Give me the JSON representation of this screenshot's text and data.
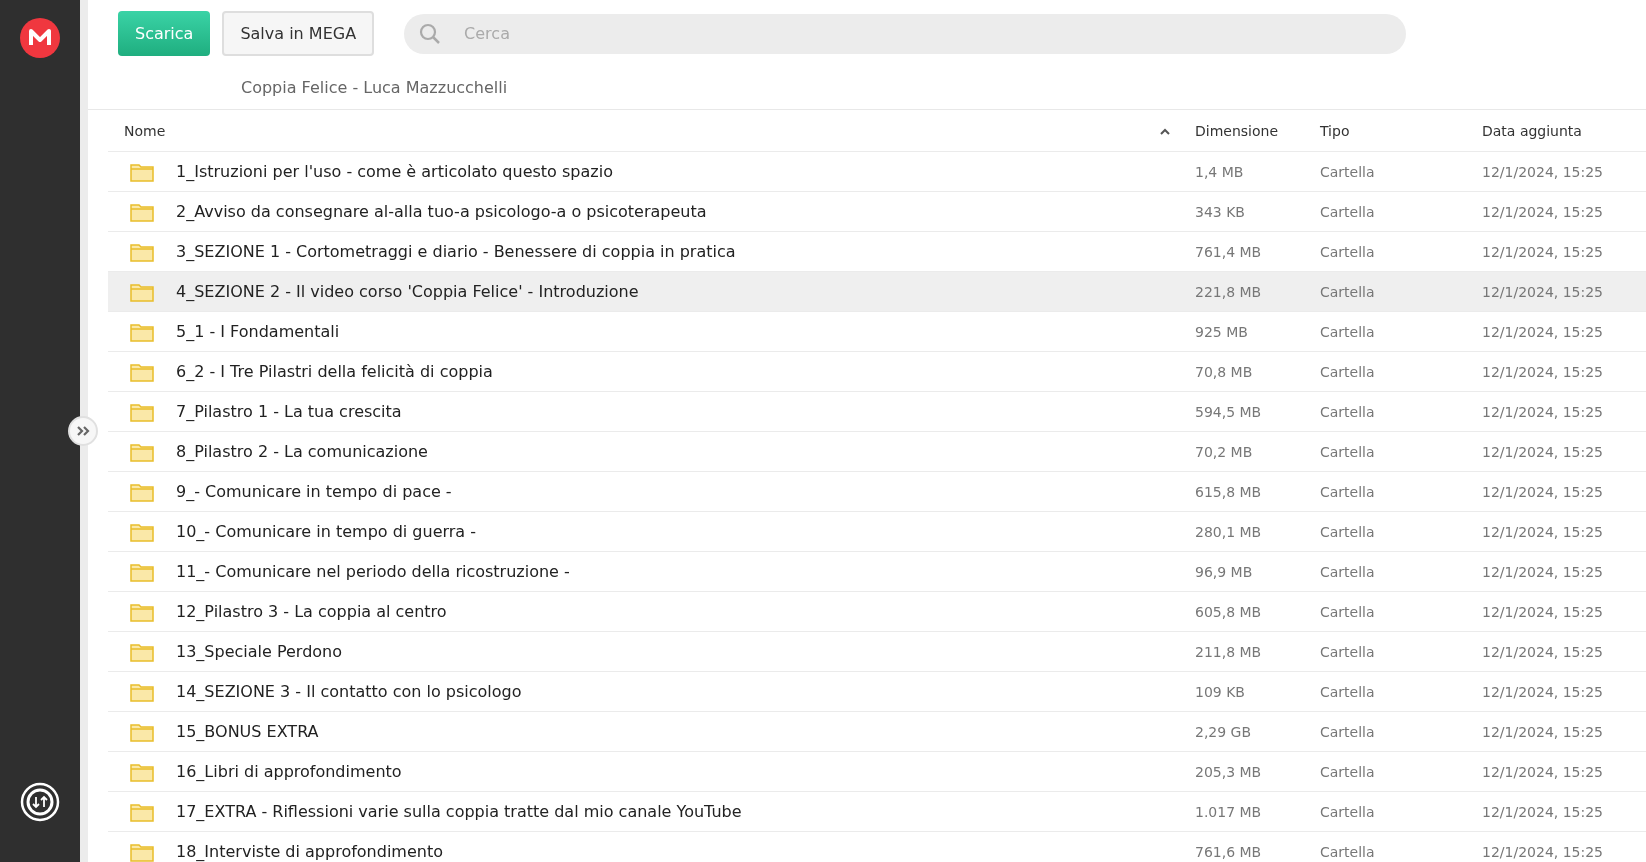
{
  "toolbar": {
    "download_label": "Scarica",
    "save_label": "Salva in MEGA",
    "search": {
      "placeholder": "Cerca"
    }
  },
  "breadcrumb": "Coppia Felice - Luca Mazzucchelli",
  "table": {
    "columns": [
      {
        "label": "Nome",
        "sorted": true
      },
      {
        "label": "Dimensione",
        "sorted": false
      },
      {
        "label": "Tipo",
        "sorted": false
      },
      {
        "label": "Data aggiunta",
        "sorted": false
      }
    ],
    "rows": [
      {
        "name": "1_Istruzioni per l'uso - come è articolato questo spazio",
        "size": "1,4 MB",
        "type": "Cartella",
        "date": "12/1/2024, 15:25",
        "highlighted": false
      },
      {
        "name": "2_Avviso da consegnare al-alla tuo-a psicologo-a o psicoterapeuta",
        "size": "343 KB",
        "type": "Cartella",
        "date": "12/1/2024, 15:25",
        "highlighted": false
      },
      {
        "name": "3_SEZIONE 1 - Cortometraggi e diario - Benessere di coppia in pratica",
        "size": "761,4 MB",
        "type": "Cartella",
        "date": "12/1/2024, 15:25",
        "highlighted": false
      },
      {
        "name": "4_SEZIONE 2 - Il video corso 'Coppia Felice' - Introduzione",
        "size": "221,8 MB",
        "type": "Cartella",
        "date": "12/1/2024, 15:25",
        "highlighted": true
      },
      {
        "name": "5_1 - I Fondamentali",
        "size": "925 MB",
        "type": "Cartella",
        "date": "12/1/2024, 15:25",
        "highlighted": false
      },
      {
        "name": "6_2 - I Tre Pilastri della felicità di coppia",
        "size": "70,8 MB",
        "type": "Cartella",
        "date": "12/1/2024, 15:25",
        "highlighted": false
      },
      {
        "name": "7_Pilastro 1 - La tua crescita",
        "size": "594,5 MB",
        "type": "Cartella",
        "date": "12/1/2024, 15:25",
        "highlighted": false
      },
      {
        "name": "8_Pilastro 2 - La comunicazione",
        "size": "70,2 MB",
        "type": "Cartella",
        "date": "12/1/2024, 15:25",
        "highlighted": false
      },
      {
        "name": "9_- Comunicare in tempo di pace -",
        "size": "615,8 MB",
        "type": "Cartella",
        "date": "12/1/2024, 15:25",
        "highlighted": false
      },
      {
        "name": "10_- Comunicare in tempo di guerra -",
        "size": "280,1 MB",
        "type": "Cartella",
        "date": "12/1/2024, 15:25",
        "highlighted": false
      },
      {
        "name": "11_- Comunicare nel periodo della ricostruzione -",
        "size": "96,9 MB",
        "type": "Cartella",
        "date": "12/1/2024, 15:25",
        "highlighted": false
      },
      {
        "name": "12_Pilastro 3 - La coppia al centro",
        "size": "605,8 MB",
        "type": "Cartella",
        "date": "12/1/2024, 15:25",
        "highlighted": false
      },
      {
        "name": "13_Speciale Perdono",
        "size": "211,8 MB",
        "type": "Cartella",
        "date": "12/1/2024, 15:25",
        "highlighted": false
      },
      {
        "name": "14_SEZIONE 3 - Il contatto con lo psicologo",
        "size": "109 KB",
        "type": "Cartella",
        "date": "12/1/2024, 15:25",
        "highlighted": false
      },
      {
        "name": "15_BONUS EXTRA",
        "size": "2,29 GB",
        "type": "Cartella",
        "date": "12/1/2024, 15:25",
        "highlighted": false
      },
      {
        "name": "16_Libri di approfondimento",
        "size": "205,3 MB",
        "type": "Cartella",
        "date": "12/1/2024, 15:25",
        "highlighted": false
      },
      {
        "name": "17_EXTRA - Riflessioni varie sulla coppia tratte dal mio canale YouTube",
        "size": "1.017 MB",
        "type": "Cartella",
        "date": "12/1/2024, 15:25",
        "highlighted": false
      },
      {
        "name": "18_Interviste di approfondimento",
        "size": "761,6 MB",
        "type": "Cartella",
        "date": "12/1/2024, 15:25",
        "highlighted": false
      }
    ]
  }
}
